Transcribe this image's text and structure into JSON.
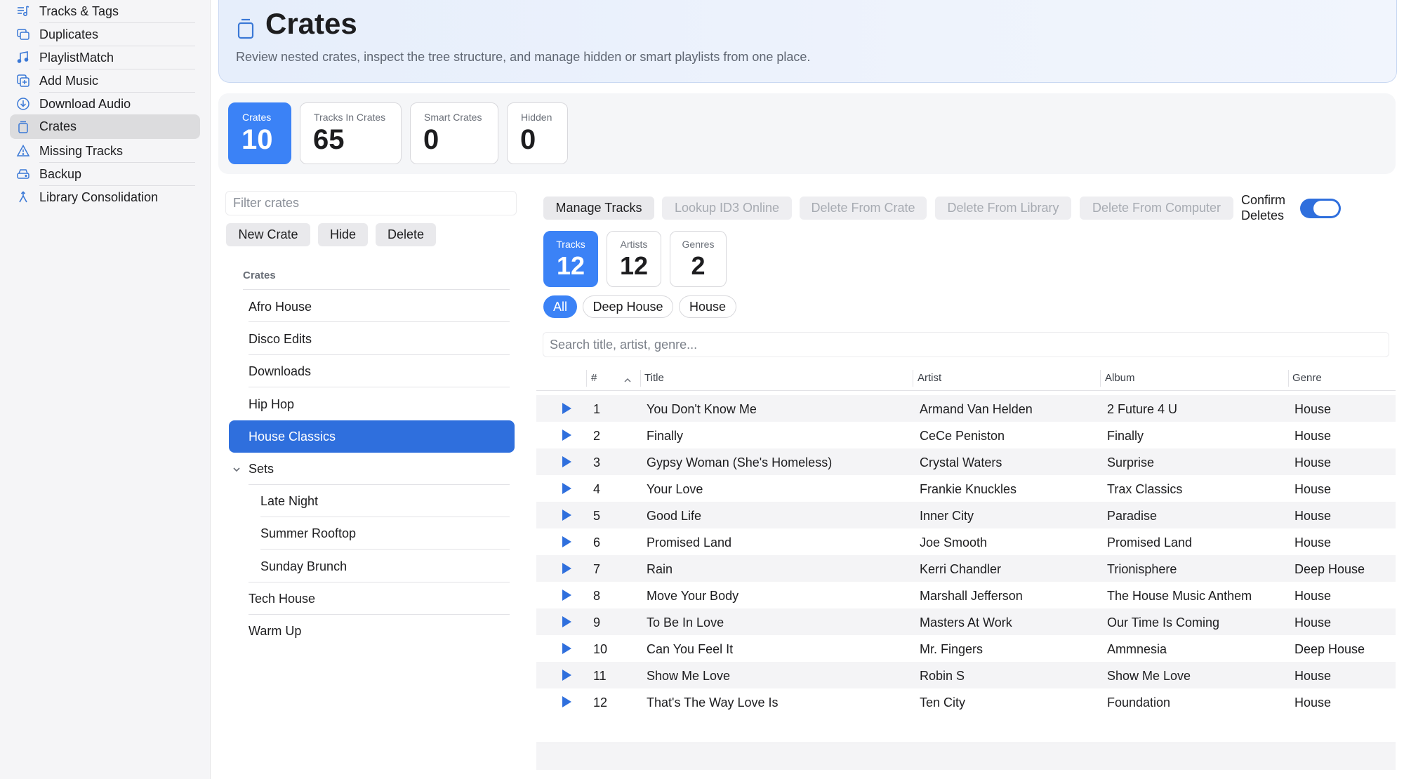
{
  "sidebar": {
    "items": [
      {
        "label": "Tracks & Tags",
        "icon": "tracks-tags-icon"
      },
      {
        "label": "Duplicates",
        "icon": "duplicates-icon"
      },
      {
        "label": "PlaylistMatch",
        "icon": "playlist-match-icon"
      },
      {
        "label": "Add Music",
        "icon": "add-music-icon"
      },
      {
        "label": "Download Audio",
        "icon": "download-icon"
      },
      {
        "label": "Crates",
        "icon": "crate-icon",
        "selected": true
      },
      {
        "label": "Missing Tracks",
        "icon": "warning-icon"
      },
      {
        "label": "Backup",
        "icon": "backup-drive-icon"
      },
      {
        "label": "Library Consolidation",
        "icon": "merge-icon"
      }
    ]
  },
  "header": {
    "title": "Crates",
    "subtitle": "Review nested crates, inspect the tree structure, and manage hidden or smart playlists from one place.",
    "icon": "crate-icon"
  },
  "stats": [
    {
      "label": "Crates",
      "value": "10",
      "active": true
    },
    {
      "label": "Tracks In Crates",
      "value": "65"
    },
    {
      "label": "Smart Crates",
      "value": "0"
    },
    {
      "label": "Hidden",
      "value": "0"
    }
  ],
  "crate_panel": {
    "filter_placeholder": "Filter crates",
    "buttons": {
      "new": "New Crate",
      "hide": "Hide",
      "delete": "Delete"
    },
    "tree_header": "Crates",
    "tree": [
      {
        "label": "Afro House"
      },
      {
        "label": "Disco Edits"
      },
      {
        "label": "Downloads"
      },
      {
        "label": "Hip Hop"
      },
      {
        "label": "House Classics",
        "selected": true
      },
      {
        "label": "Sets",
        "expanded": true
      },
      {
        "label": "Late Night",
        "child": true
      },
      {
        "label": "Summer Rooftop",
        "child": true
      },
      {
        "label": "Sunday Brunch",
        "child": true
      },
      {
        "label": "Tech House"
      },
      {
        "label": "Warm Up"
      }
    ]
  },
  "toolbar": {
    "manage_tracks": "Manage Tracks",
    "lookup_id3": "Lookup ID3 Online",
    "delete_from_crate": "Delete From Crate",
    "delete_from_library": "Delete From Library",
    "delete_from_computer": "Delete From Computer",
    "confirm_deletes_line1": "Confirm",
    "confirm_deletes_line2": "Deletes",
    "confirm_deletes_on": true
  },
  "crate_stats": [
    {
      "label": "Tracks",
      "value": "12",
      "active": true
    },
    {
      "label": "Artists",
      "value": "12"
    },
    {
      "label": "Genres",
      "value": "2"
    }
  ],
  "genre_filters": [
    {
      "label": "All",
      "active": true
    },
    {
      "label": "Deep House"
    },
    {
      "label": "House"
    }
  ],
  "search": {
    "placeholder": "Search title, artist, genre..."
  },
  "table": {
    "columns": {
      "num": "#",
      "title": "Title",
      "artist": "Artist",
      "album": "Album",
      "genre": "Genre"
    },
    "rows": [
      {
        "num": "1",
        "title": "You Don't Know Me",
        "artist": "Armand Van Helden",
        "album": "2 Future 4 U",
        "genre": "House"
      },
      {
        "num": "2",
        "title": "Finally",
        "artist": "CeCe Peniston",
        "album": "Finally",
        "genre": "House"
      },
      {
        "num": "3",
        "title": "Gypsy Woman (She's Homeless)",
        "artist": "Crystal Waters",
        "album": "Surprise",
        "genre": "House"
      },
      {
        "num": "4",
        "title": "Your Love",
        "artist": "Frankie Knuckles",
        "album": "Trax Classics",
        "genre": "House"
      },
      {
        "num": "5",
        "title": "Good Life",
        "artist": "Inner City",
        "album": "Paradise",
        "genre": "House"
      },
      {
        "num": "6",
        "title": "Promised Land",
        "artist": "Joe Smooth",
        "album": "Promised Land",
        "genre": "House"
      },
      {
        "num": "7",
        "title": "Rain",
        "artist": "Kerri Chandler",
        "album": "Trionisphere",
        "genre": "Deep House"
      },
      {
        "num": "8",
        "title": "Move Your Body",
        "artist": "Marshall Jefferson",
        "album": "The House Music Anthem",
        "genre": "House"
      },
      {
        "num": "9",
        "title": "To Be In Love",
        "artist": "Masters At Work",
        "album": "Our Time Is Coming",
        "genre": "House"
      },
      {
        "num": "10",
        "title": "Can You Feel It",
        "artist": "Mr. Fingers",
        "album": "Ammnesia",
        "genre": "Deep House"
      },
      {
        "num": "11",
        "title": "Show Me Love",
        "artist": "Robin S",
        "album": "Show Me Love",
        "genre": "House"
      },
      {
        "num": "12",
        "title": "That's The Way Love Is",
        "artist": "Ten City",
        "album": "Foundation",
        "genre": "House"
      }
    ]
  },
  "colors": {
    "accent": "#3b82f6",
    "selection": "#2f6fdd",
    "sidebar_bg": "#f5f5f7"
  }
}
